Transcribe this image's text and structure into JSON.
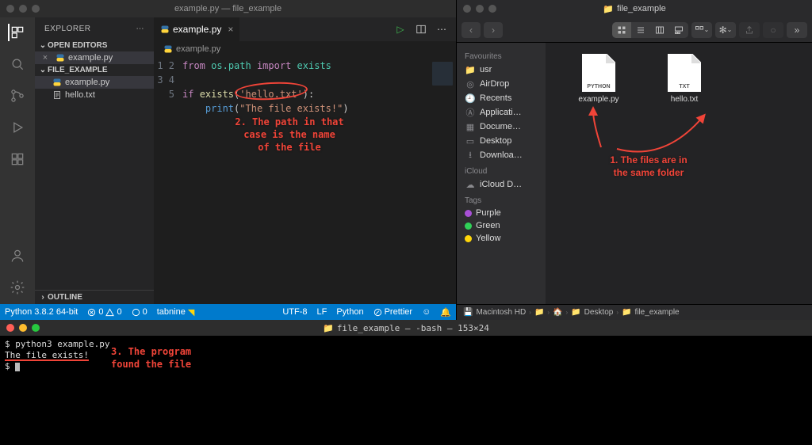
{
  "vscode": {
    "title": "example.py — file_example",
    "explorer_label": "EXPLORER",
    "open_editors_label": "OPEN EDITORS",
    "project_label": "FILE_EXAMPLE",
    "outline_label": "OUTLINE",
    "open_editor_file": "example.py",
    "files": [
      {
        "name": "example.py",
        "icon": "python"
      },
      {
        "name": "hello.txt",
        "icon": "text"
      }
    ],
    "tab_filename": "example.py",
    "breadcrumb_filename": "example.py",
    "code": {
      "l1_from": "from",
      "l1_ospath": "os.path",
      "l1_import": "import",
      "l1_exists": "exists",
      "l3_if": "if",
      "l3_fn": "exists",
      "l3_arg": "'hello.txt'",
      "l3_close": "):",
      "l4_print": "print",
      "l4_str": "\"The file exists!\"",
      "l4_close": ")"
    },
    "statusbar": {
      "python": "Python 3.8.2 64-bit",
      "errors": "0",
      "warnings": "0",
      "jupyter": "0",
      "tabnine": "tabnine",
      "encoding": "UTF-8",
      "eol": "LF",
      "lang": "Python",
      "prettier": "Prettier"
    },
    "annotation": "2. The path in that\ncase is the name\nof the file"
  },
  "finder": {
    "title": "file_example",
    "groups": {
      "favourites": "Favourites",
      "icloud": "iCloud",
      "tags": "Tags"
    },
    "favourites": [
      "usr",
      "AirDrop",
      "Recents",
      "Applicati…",
      "Docume…",
      "Desktop",
      "Downloa…"
    ],
    "icloud": [
      "iCloud D…"
    ],
    "tags": [
      {
        "label": "Purple",
        "color": "#a850d6"
      },
      {
        "label": "Green",
        "color": "#30d158"
      },
      {
        "label": "Yellow",
        "color": "#ffd60a"
      }
    ],
    "files": [
      {
        "name": "example.py",
        "badge": "PYTHON"
      },
      {
        "name": "hello.txt",
        "badge": "TXT"
      }
    ],
    "path": [
      "Macintosh HD",
      "",
      "",
      "Desktop",
      "file_example"
    ],
    "annotation": "1. The files are in\nthe same folder"
  },
  "terminal": {
    "title": "file_example — -bash — 153×24",
    "line1": "$ python3 example.py",
    "line2": "The file exists!",
    "prompt": "$ ",
    "annotation": "3. The program\nfound the file"
  }
}
